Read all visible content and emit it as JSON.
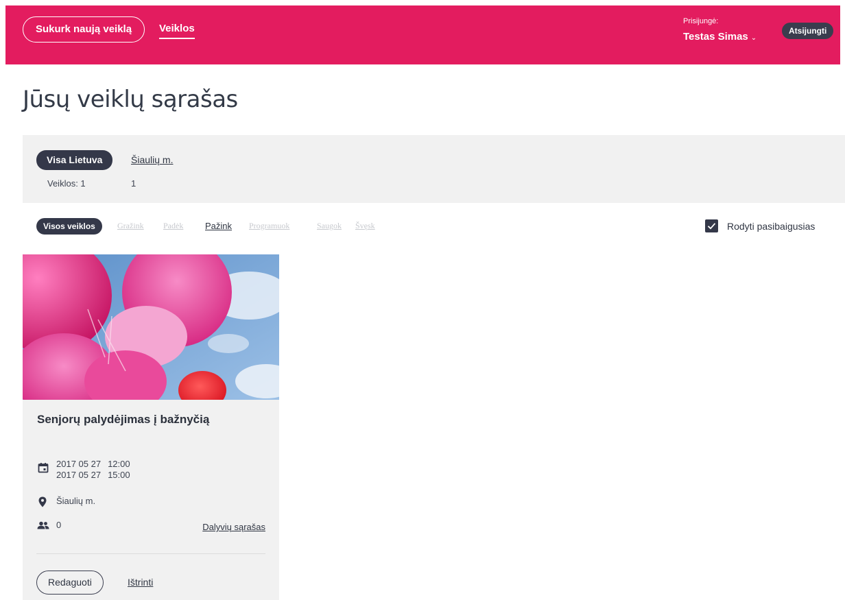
{
  "header": {
    "create_label": "Sukurk naują veiklą",
    "nav_label": "Veiklos",
    "login_label": "Prisijungė:",
    "user_name": "Testas Simas",
    "logout_label": "Atsijungti"
  },
  "page": {
    "title": "Jūsų veiklų sąrašas"
  },
  "regions": {
    "all_label": "Visa Lietuva",
    "all_count": "Veiklos: 1",
    "city_label": "Šiaulių m.",
    "city_count": "1"
  },
  "filters": {
    "all_label": "Visos veiklos",
    "items": [
      "Gražink",
      "Padėk",
      "Pažink",
      "Programuok",
      "Saugok",
      "Švęsk"
    ],
    "active": "Pažink",
    "show_ended_label": "Rodyti pasibaigusias",
    "show_ended_checked": true
  },
  "card": {
    "title": "Senjorų palydėjimas į bažnyčią",
    "start_date": "2017 05 27",
    "start_time": "12:00",
    "end_date": "2017 05 27",
    "end_time": "15:00",
    "location": "Šiaulių m.",
    "participants": "0",
    "participants_link": "Dalyvių sąrašas",
    "edit_label": "Redaguoti",
    "delete_label": "Ištrinti"
  },
  "colors": {
    "brand": "#e31c5f",
    "dark": "#343849",
    "panel": "#f1f1f1"
  }
}
